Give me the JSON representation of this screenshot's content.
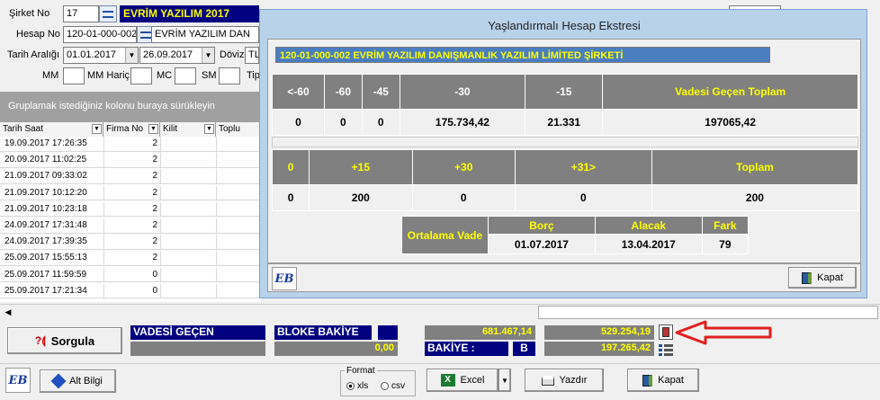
{
  "form": {
    "sirket_label": "Şirket No",
    "sirket_no": "17",
    "sirket_name": "EVRİM YAZILIM 2017",
    "hesap_label": "Hesap No",
    "hesap_no": "120-01-000-002",
    "hesap_name": "EVRİM YAZILIM DAN",
    "tarih_label": "Tarih Aralığı",
    "tarih_from": "01.01.2017",
    "tarih_to": "26.09.2017",
    "doviz_label": "Döviz",
    "doviz_value": "TL",
    "mm_label": "MM",
    "mm_haric_label": "MM Hariç",
    "mc_label": "MC",
    "sm_label": "SM",
    "tip_label": "Tip"
  },
  "grid": {
    "group_hint": "Gruplamak istediğiniz kolonu buraya sürükleyin",
    "columns": [
      "Tarih Saat",
      "Firma No",
      "Kilit",
      "Toplu"
    ],
    "rows": [
      {
        "date": "19.09.2017 17:26:35",
        "firma": "2"
      },
      {
        "date": "20.09.2017 11:02:25",
        "firma": "2"
      },
      {
        "date": "21.09.2017 09:33:02",
        "firma": "2"
      },
      {
        "date": "21.09.2017 10:12:20",
        "firma": "2"
      },
      {
        "date": "21.09.2017 10:23:18",
        "firma": "2"
      },
      {
        "date": "24.09.2017 17:31:48",
        "firma": "2"
      },
      {
        "date": "24.09.2017 17:39:35",
        "firma": "2"
      },
      {
        "date": "25.09.2017 15:55:13",
        "firma": "2"
      },
      {
        "date": "25.09.2017 11:59:59",
        "firma": "0"
      },
      {
        "date": "25.09.2017 17:21:34",
        "firma": "0"
      }
    ]
  },
  "dialog": {
    "title": "Yaşlandırmalı Hesap Ekstresi",
    "company": "120-01-000-002 EVRİM YAZILIM DANIŞMANLIK YAZILIM LİMİTED ŞİRKETİ",
    "aging1_headers": [
      "<-60",
      "-60",
      "-45",
      "-30",
      "-15",
      "Vadesi Geçen Toplam"
    ],
    "aging1_values": [
      "0",
      "0",
      "0",
      "175.734,42",
      "21.331",
      "197065,42"
    ],
    "aging2_headers": [
      "0",
      "+15",
      "+30",
      "+31>",
      "Toplam"
    ],
    "aging2_values": [
      "0",
      "200",
      "0",
      "0",
      "200"
    ],
    "avg_label": "Ortalama Vade",
    "avg_headers": [
      "Borç",
      "Alacak",
      "Fark"
    ],
    "avg_values": [
      "01.07.2017",
      "13.04.2017",
      "79"
    ],
    "close_label": "Kapat",
    "logo": "EB"
  },
  "summary": {
    "sorgula_label": "Sorgula",
    "vadesi_gecen_label": "VADESİ GEÇEN",
    "bloke_bakiye_label": "BLOKE BAKİYE",
    "value1": "681.467,14",
    "value2": "529.254,19",
    "bloke_value": "0,00",
    "bakiye_label": "BAKİYE   :",
    "bakiye_type": "B",
    "bakiye_value": "197.265,42"
  },
  "footer": {
    "logo": "EB",
    "alt_bilgi_label": "Alt Bilgi",
    "format_label": "Format",
    "format_xls": "xls",
    "format_csv": "csv",
    "excel_label": "Excel",
    "yazdir_label": "Yazdır",
    "kapat_label": "Kapat"
  }
}
